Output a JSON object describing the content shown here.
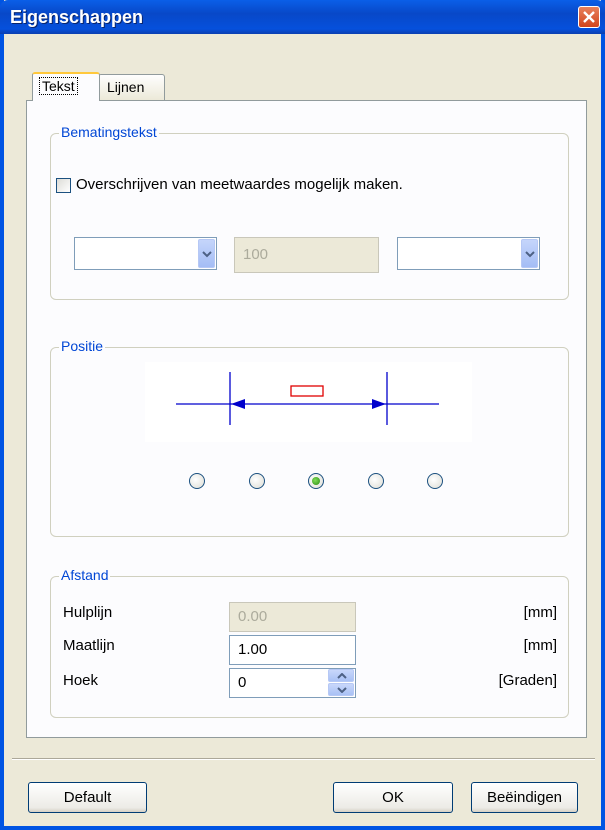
{
  "window": {
    "title": "Eigenschappen"
  },
  "tabs": [
    {
      "label": "Tekst",
      "active": true
    },
    {
      "label": "Lijnen",
      "active": false
    }
  ],
  "bematingstekst": {
    "legend": "Bematingstekst",
    "checkbox_label": "Overschrijven van meetwaardes mogelijk maken.",
    "checkbox_checked": false,
    "left_combo_value": "",
    "center_value": "100",
    "right_combo_value": ""
  },
  "positie": {
    "legend": "Positie",
    "options_count": 5,
    "selected_index": 2
  },
  "afstand": {
    "legend": "Afstand",
    "rows": [
      {
        "label": "Hulplijn",
        "value": "0.00",
        "unit": "[mm]",
        "disabled": true
      },
      {
        "label": "Maatlijn",
        "value": "1.00",
        "unit": "[mm]",
        "disabled": false
      },
      {
        "label": "Hoek",
        "value": "0",
        "unit": "[Graden]",
        "disabled": false
      }
    ]
  },
  "buttons": {
    "default": "Default",
    "ok": "OK",
    "end": "Beëindigen"
  },
  "colors": {
    "titlebar": "#0054e3",
    "legend_text": "#0046d5",
    "dimension_line": "#0000cc",
    "text_marker": "#e00000"
  }
}
